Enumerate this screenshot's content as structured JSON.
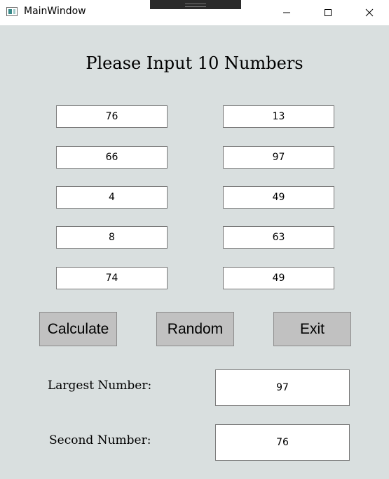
{
  "window": {
    "title": "MainWindow",
    "controls": {
      "minimize_icon": "minimize-icon",
      "maximize_icon": "maximize-icon",
      "close_icon": "close-icon"
    }
  },
  "form": {
    "heading": "Please Input 10 Numbers",
    "inputs": [
      "76",
      "13",
      "66",
      "97",
      "4",
      "49",
      "8",
      "63",
      "74",
      "49"
    ]
  },
  "buttons": {
    "calculate": "Calculate",
    "random": "Random",
    "exit": "Exit"
  },
  "results": {
    "largest_label": "Largest Number:",
    "largest_value": "97",
    "second_label": "Second Number:",
    "second_value": "76"
  },
  "colors": {
    "background": "#d9dfdf",
    "button": "#c1c1c1",
    "field": "#ffffff"
  }
}
